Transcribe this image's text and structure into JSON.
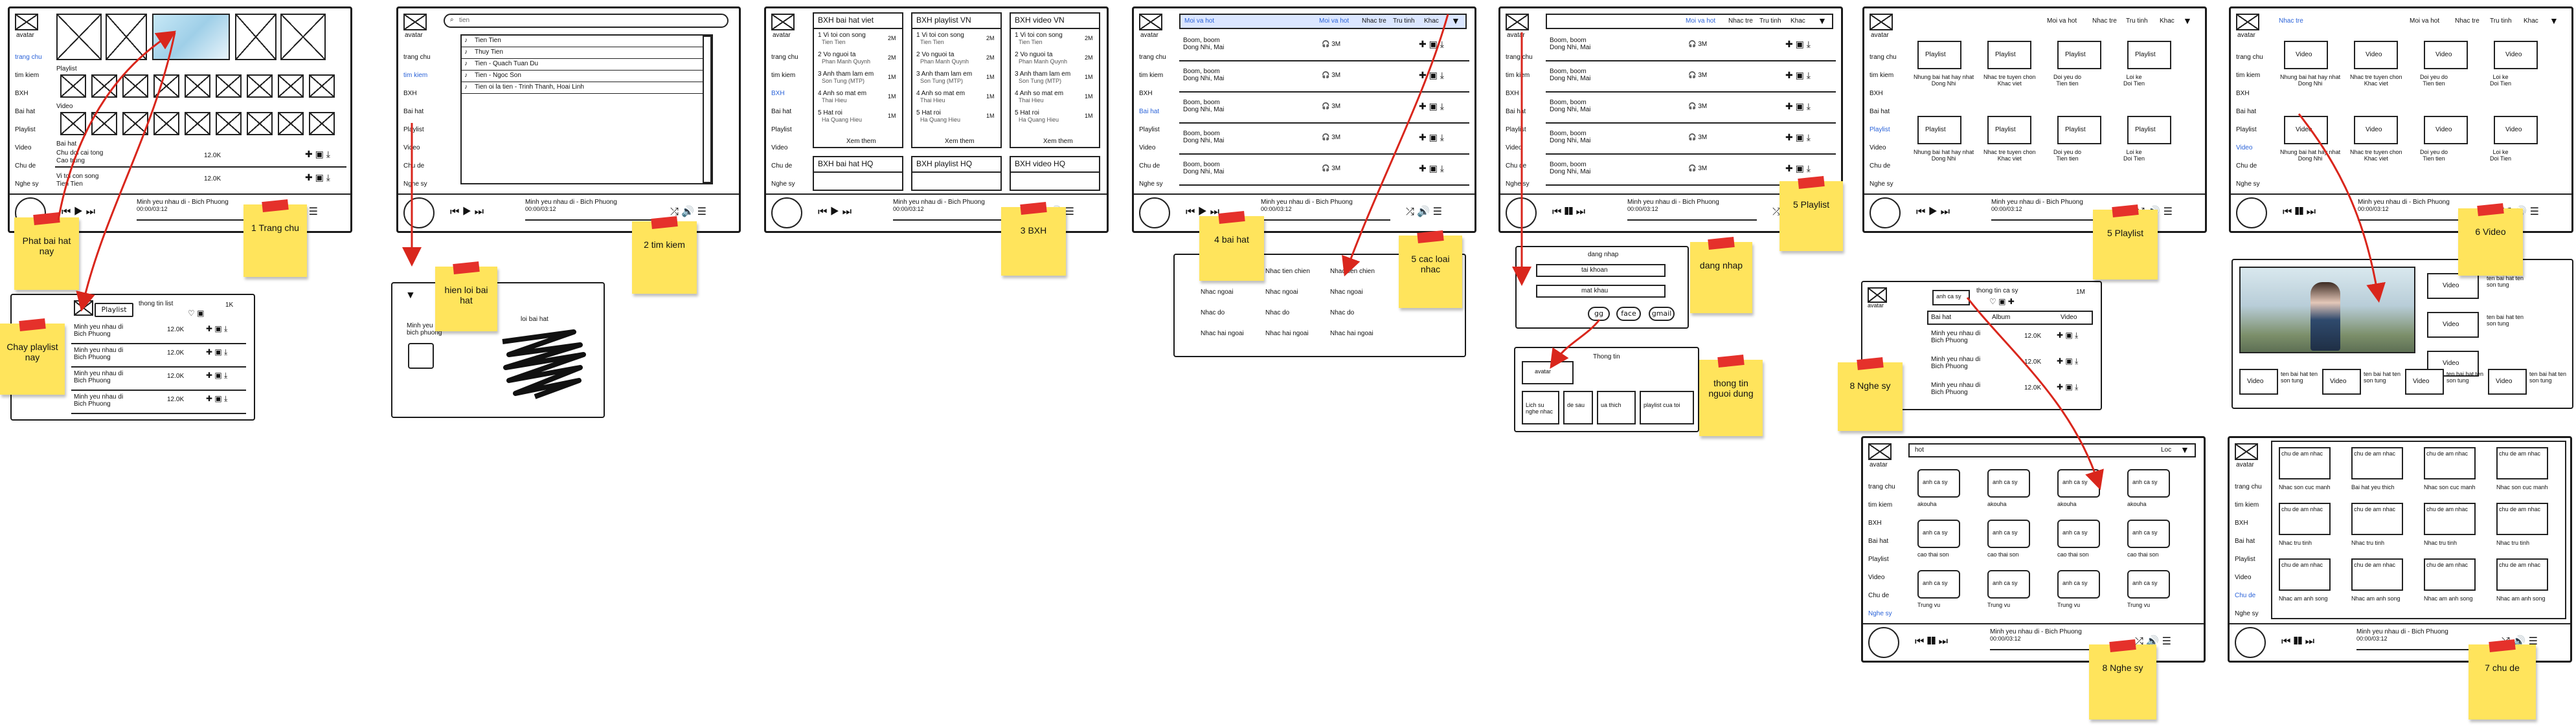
{
  "nav": {
    "avatar": "avatar",
    "items": [
      "trang chu",
      "tim kiem",
      "BXH",
      "Bai hat",
      "Playlist",
      "Video",
      "Chu de",
      "Nghe sy"
    ],
    "items_alt": [
      "trang chu",
      "tim kiem",
      "BXH",
      "Bai hat",
      "Playlist",
      "Video",
      "Chu de",
      "Nghe sy"
    ]
  },
  "player": {
    "song": "Minh yeu nhau di - Bich Phuong",
    "time": "00:00/03:12"
  },
  "screen1": {
    "playlist_label": "Playlist",
    "video_label": "Video",
    "baihat_label": "Bai hat",
    "row1_title": "Chu doi cai tong",
    "row1_sub": "Cao trung",
    "row1_count": "12.0K",
    "row2_title": "Vi toi con song",
    "row2_sub": "Tien Tien",
    "row2_count": "12.0K"
  },
  "playlist_detail": {
    "button": "Playlist",
    "info": "thong tin list",
    "count": "1K",
    "rows": [
      "Minh yeu nhau di\nBich Phuong",
      "Minh yeu nhau di\nBich Phuong",
      "Minh yeu nhau di\nBich Phuong",
      "Minh yeu nhau di\nBich Phuong"
    ],
    "row_count": "12.0K"
  },
  "search": {
    "placeholder": "tien",
    "results": [
      "Tien Tien",
      "Thuy Tien",
      "Tien - Quach Tuan Du",
      "Tien - Ngoc Son",
      "Tien oi la tien - Trinh Thanh, Hoai Linh"
    ]
  },
  "lyrics": {
    "title": "Minh yeu nhau di\nbich phuong",
    "label": "loi bai hat"
  },
  "bxh": {
    "col_titles": [
      "BXH bai hat viet",
      "BXH playlist VN",
      "BXH video VN"
    ],
    "bottom_titles": [
      "BXH bai hat HQ",
      "BXH playlist HQ",
      "BXH video HQ"
    ],
    "items": [
      {
        "t": "1 Vi toi con song",
        "s": "Tien Tien",
        "c": "2M"
      },
      {
        "t": "2 Vo nguoi ta",
        "s": "Phan Manh Quynh",
        "c": "2M"
      },
      {
        "t": "3 Anh tham lam em",
        "s": "Son Tung (MTP)",
        "c": "1M"
      },
      {
        "t": "4 Anh so mat em",
        "s": "Thai Hieu",
        "c": "1M"
      },
      {
        "t": "5 Hat roi",
        "s": "Ha Quang Hieu",
        "c": "1M"
      }
    ],
    "see_more": "Xem them"
  },
  "baihat": {
    "tabs": [
      "Moi va hot",
      "Nhac tre",
      "Tru tinh",
      "Khac"
    ],
    "rows": [
      "Boom, boom\nDong Nhi, Mai",
      "Boom, boom\nDong Nhi, Mai",
      "Boom, boom\nDong Nhi, Mai",
      "Boom, boom\nDong Nhi, Mai",
      "Boom, boom\nDong Nhi, Mai"
    ],
    "row_count": "3M",
    "genres": [
      [
        "Nhac tien chien",
        "Nhac tien chien",
        "Nhac tien chien"
      ],
      [
        "Nhac ngoai",
        "Nhac ngoai",
        "Nhac ngoai"
      ],
      [
        "Nhac do",
        "Nhac do",
        "Nhac do"
      ],
      [
        "Nhac hai ngoai",
        "Nhac hai ngoai",
        "Nhac hai ngoai"
      ]
    ]
  },
  "login": {
    "title": "dang nhap",
    "user": "tai khoan",
    "pass": "mat khau",
    "btn1": "gg",
    "btn2": "face",
    "btn3": "gmail"
  },
  "userinfo": {
    "title": "Thong tin",
    "avatar": "avatar",
    "cells": [
      "Lich su\nnghe nhac",
      "de sau",
      "ua thich",
      "playlist cua toi"
    ]
  },
  "playlists": {
    "tabs": [
      "Moi va hot",
      "Nhac tre",
      "Tru tinh",
      "Khac"
    ],
    "label": "Playlist",
    "captions": [
      "Nhung bai hat hay nhat\nDong Nhi",
      "Nhac tre tuyen chon\nKhac viet",
      "Doi yeu do\nTien tien",
      "Loi ke\nDoi Tien"
    ]
  },
  "videos": {
    "tabs": [
      "Moi va hot",
      "Nhac tre",
      "Tru tinh",
      "Khac"
    ],
    "label": "Video",
    "captions": [
      "Nhung bai hat hay nhat\nDong Nhi",
      "Nhac tre tuyen chon\nKhac viet",
      "Doi yeu do\nTien tien",
      "Loi ke\nDoi Tien"
    ],
    "side": [
      "ten bai hat ten\nson tung",
      "ten bai hat ten\nson tung"
    ]
  },
  "artist": {
    "avatar": "anh ca sy",
    "info": "thong tin ca sy",
    "count": "1M",
    "tabs": [
      "Bai hat",
      "Album",
      "Video"
    ],
    "rows": [
      "Minh yeu nhau di\nBich Phuong",
      "Minh yeu nhau di\nBich Phuong",
      "Minh yeu nhau di\nBich Phuong"
    ],
    "row_count": "12.0K"
  },
  "artists": {
    "filter": "hot",
    "filter_right": "Loc",
    "cell": "anh ca sy",
    "names": [
      "akouha",
      "akouha",
      "akouha",
      "akouha",
      "cao thai son",
      "cao thai son",
      "cao thai son",
      "cao thai son",
      "Trung vu",
      "Trung vu",
      "Trung vu",
      "Trung vu"
    ]
  },
  "topics": {
    "cell": "chu de am nhac",
    "names": [
      "Nhac son cuc manh",
      "Bai hat yeu thich",
      "Nhac son cuc manh",
      "Nhac son cuc manh",
      "Nhac tru tinh",
      "Nhac tru tinh",
      "Nhac tru tinh",
      "Nhac tru tinh",
      "Nhac am anh song",
      "Nhac am anh song",
      "Nhac am anh song",
      "Nhac am anh song"
    ]
  },
  "notes": {
    "n1": "1 Trang chu",
    "n2": "2 tim kiem",
    "n3": "3 BXH",
    "n4": "4 bai hat",
    "n5": "5 cac loai\nnhac",
    "n5b": "5 Playlist",
    "n6": "6 Video",
    "n7": "7 chu de",
    "n8a": "8 Nghe sy",
    "n8b": "8 Nghe sy",
    "play": "Phat bai hat\nnay",
    "chay": "Chay playlist\nnay",
    "lyric": "hien loi bai\nhat",
    "login": "dang nhap",
    "user": "thong tin\nnguoi dung"
  }
}
